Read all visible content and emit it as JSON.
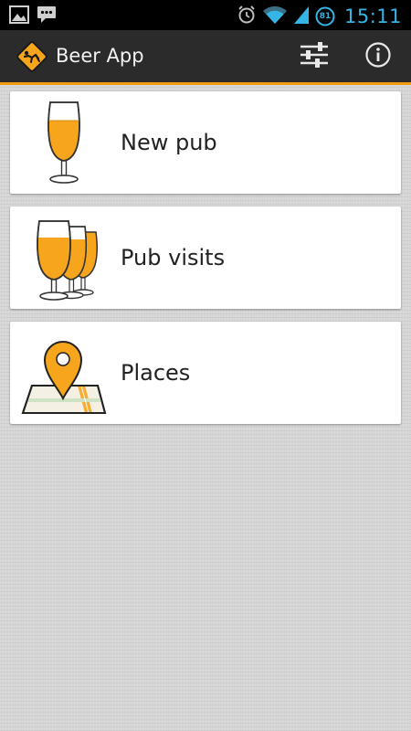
{
  "status_bar": {
    "time": "15:11",
    "battery_level": "81",
    "left_icons": [
      "image-icon",
      "chat-icon"
    ],
    "right_icons": [
      "alarm-icon",
      "wifi-icon",
      "signal-icon",
      "battery-icon"
    ]
  },
  "action_bar": {
    "title": "Beer App",
    "logo_icon": "drunk-sign-icon",
    "actions": [
      "settings-sliders-icon",
      "info-icon"
    ]
  },
  "menu": {
    "items": [
      {
        "label": "New pub",
        "icon": "beer-glass-icon"
      },
      {
        "label": "Pub visits",
        "icon": "beer-glasses-icon"
      },
      {
        "label": "Places",
        "icon": "map-pin-icon"
      }
    ]
  },
  "colors": {
    "accent": "#f39c12",
    "beer": "#f7a51c",
    "status_time": "#34b5e5",
    "action_bar_bg": "#2b2b2b",
    "card_bg": "#ffffff",
    "background": "#d6d6d6"
  }
}
